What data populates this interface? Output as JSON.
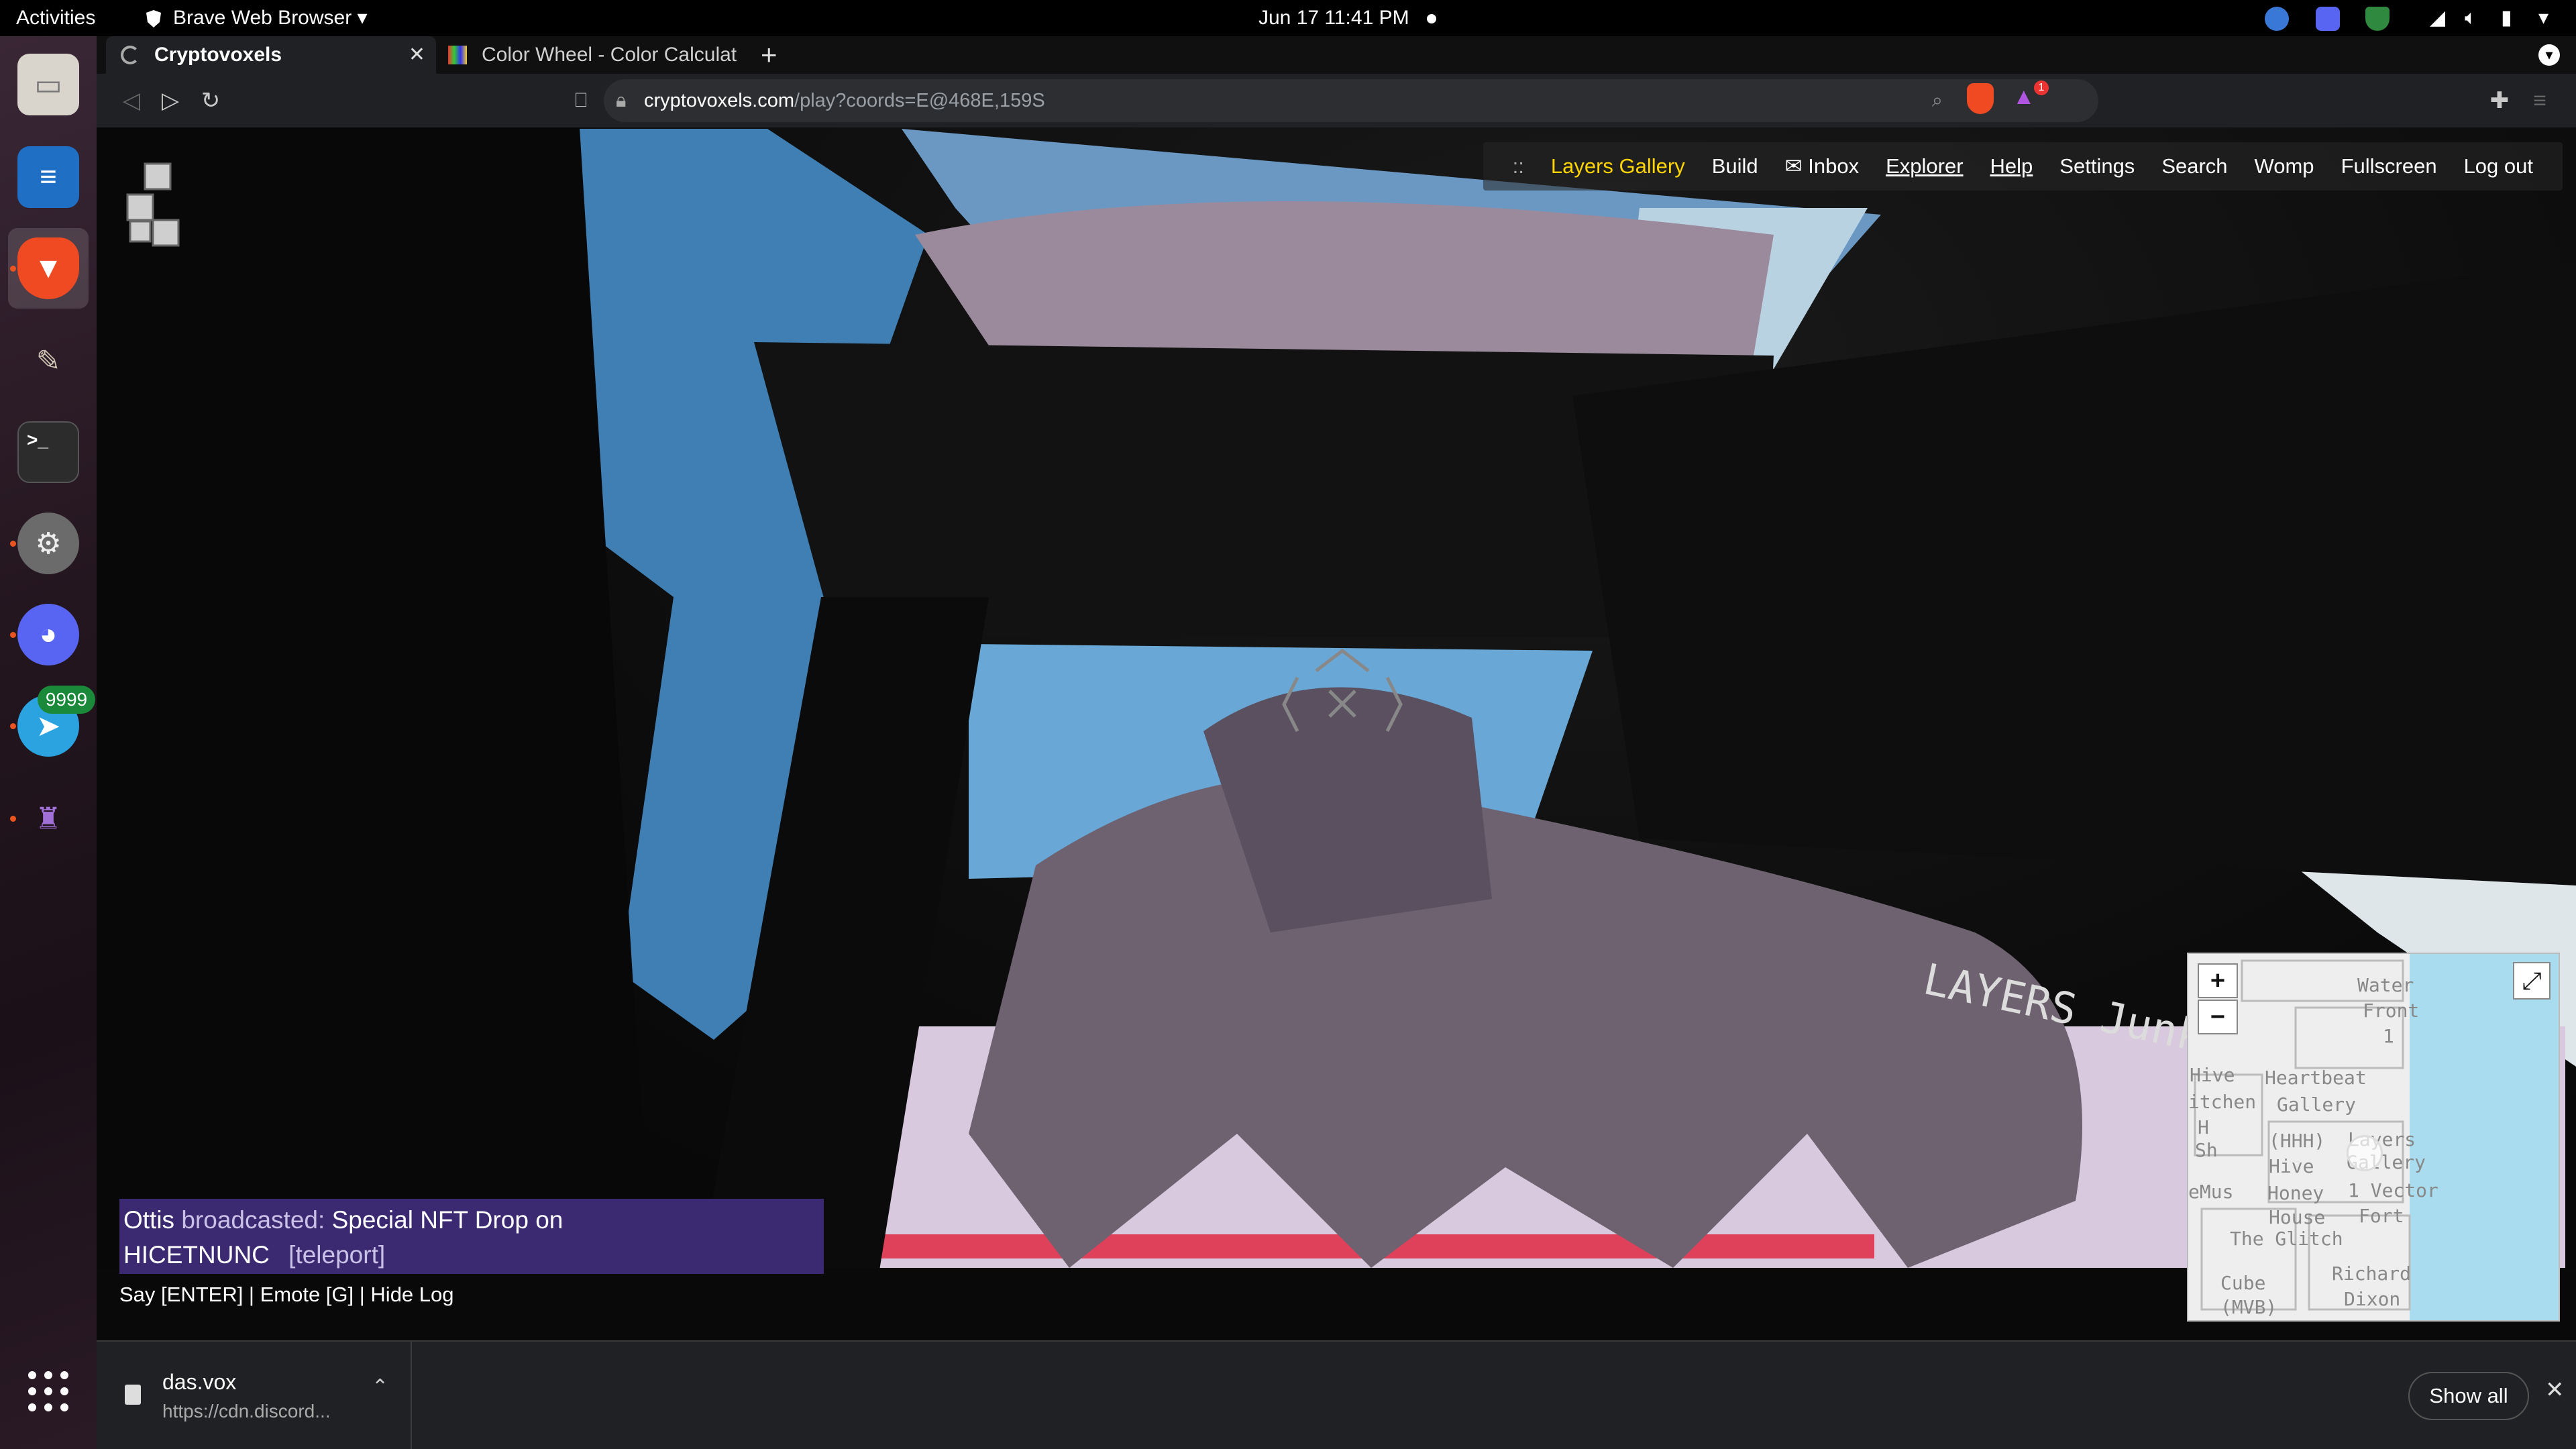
{
  "system": {
    "activities": "Activities",
    "app_name": "Brave Web Browser",
    "clock": "Jun 17  11:41 PM"
  },
  "dock": {
    "telegram_badge": "9999",
    "apps": [
      "files-icon",
      "writer-icon",
      "brave-icon",
      "gimp-icon",
      "terminal-icon",
      "settings-icon",
      "discord-icon",
      "telegram-icon",
      "app-icon",
      "show-apps-icon"
    ]
  },
  "browser": {
    "tabs": [
      {
        "title": "Cryptovoxels"
      },
      {
        "title": "Color Wheel - Color Calculato"
      }
    ],
    "url_domain": "cryptovoxels.com",
    "url_path": "/play?coords=E@468E,159S",
    "shield_badge": "1"
  },
  "game": {
    "menu": [
      "::",
      "Layers Gallery",
      "Build",
      "✉ Inbox",
      "Explorer",
      "Help",
      "Settings",
      "Search",
      "Womp",
      "Fullscreen",
      "Log out"
    ],
    "broadcast": {
      "author": "Ottis",
      "verb": "broadcasted:",
      "message_line1": "Special NFT Drop on",
      "message_line2": "HICETNUNC",
      "link": "[teleport]"
    },
    "controls": "Say [ENTER] | Emote [G] | Hide Log",
    "scene_sign": "LAYERS Junkyard",
    "minimap": {
      "zoom_in": "+",
      "zoom_out": "−",
      "labels": [
        "Water",
        "Front",
        "1",
        "Hive",
        "Heartbeat",
        "itchen",
        "Gallery",
        "H",
        "Sh",
        "(HHH)",
        "Layers",
        "Hive",
        "Gallery",
        "eMus",
        "Honey",
        "1 Vector",
        "House",
        "Fort",
        "The Glitch",
        "Cube",
        "Richard",
        "(MVB)",
        "Dixon"
      ]
    }
  },
  "downloads": {
    "file_name": "das.vox",
    "file_source": "https://cdn.discord...",
    "show_all": "Show all"
  }
}
